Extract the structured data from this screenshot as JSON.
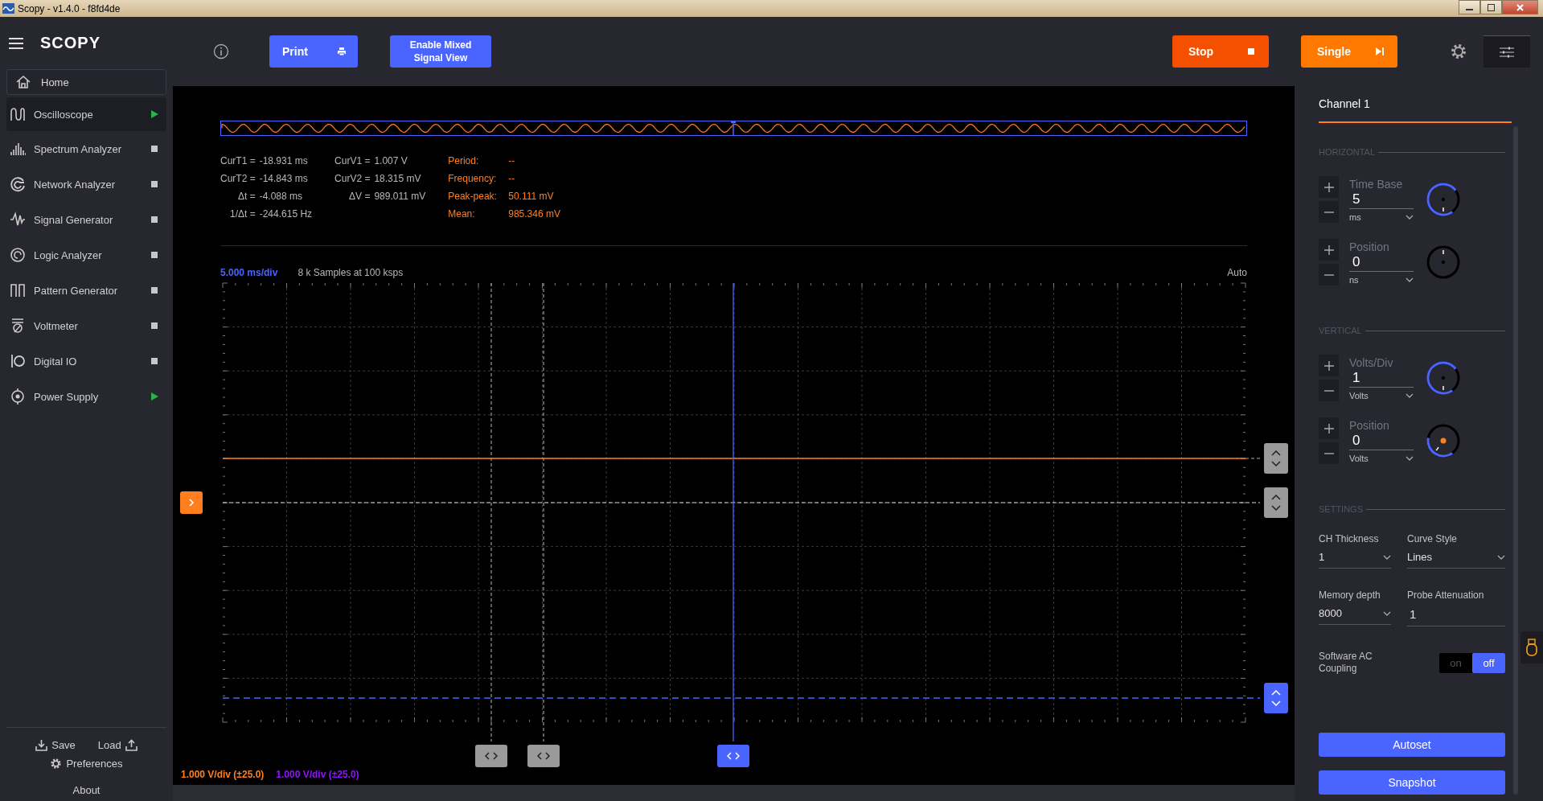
{
  "window": {
    "title": "Scopy - v1.4.0 - f8fd4de"
  },
  "sidebar": {
    "logo": "SCOPY",
    "home": "Home",
    "tools": [
      {
        "label": "Oscilloscope",
        "kind": "oscilloscope",
        "selected": true,
        "running": true
      },
      {
        "label": "Spectrum Analyzer",
        "kind": "spectrum",
        "selected": false,
        "running": false
      },
      {
        "label": "Network Analyzer",
        "kind": "network",
        "selected": false,
        "running": false
      },
      {
        "label": "Signal Generator",
        "kind": "signal",
        "selected": false,
        "running": false
      },
      {
        "label": "Logic Analyzer",
        "kind": "logic",
        "selected": false,
        "running": false
      },
      {
        "label": "Pattern Generator",
        "kind": "pattern",
        "selected": false,
        "running": false
      },
      {
        "label": "Voltmeter",
        "kind": "voltmeter",
        "selected": false,
        "running": false
      },
      {
        "label": "Digital IO",
        "kind": "digitalio",
        "selected": false,
        "running": false
      },
      {
        "label": "Power Supply",
        "kind": "power",
        "selected": false,
        "running": true
      }
    ],
    "save": "Save",
    "load": "Load",
    "preferences": "Preferences",
    "about": "About"
  },
  "toolbar": {
    "print": "Print",
    "mixed_signal": "Enable Mixed Signal View",
    "stop": "Stop",
    "single": "Single"
  },
  "cursor_readouts": {
    "time": [
      {
        "label": "CurT1 =",
        "value": "-18.931 ms"
      },
      {
        "label": "CurT2 =",
        "value": "-14.843 ms"
      },
      {
        "label": "Δt =",
        "value": "-4.088 ms"
      },
      {
        "label": "1/Δt =",
        "value": "-244.615 Hz"
      }
    ],
    "voltage": [
      {
        "label": "CurV1 =",
        "value": "1.007 V"
      },
      {
        "label": "CurV2 =",
        "value": "18.315 mV"
      },
      {
        "label": "ΔV =",
        "value": "989.011 mV"
      }
    ]
  },
  "measurements": [
    {
      "label": "Period:",
      "value": "--"
    },
    {
      "label": "Frequency:",
      "value": "--"
    },
    {
      "label": "Peak-peak:",
      "value": "50.111 mV"
    },
    {
      "label": "Mean:",
      "value": "985.346 mV"
    }
  ],
  "plot": {
    "time_div": "5.000 ms/div",
    "samples": "8 k Samples at 100 ksps",
    "trigger_mode": "Auto",
    "channel_scales": [
      {
        "text": "1.000 V/div (±25.0)",
        "color": "#ff7f1e"
      },
      {
        "text": "1.000 V/div (±25.0)",
        "color": "#9013fe"
      }
    ]
  },
  "channel_panel": {
    "tab": "Channel 1",
    "sections": [
      {
        "title": "HORIZONTAL",
        "controls": [
          {
            "label": "Time Base",
            "value": "5",
            "unit": "ms",
            "kind": "scale"
          },
          {
            "label": "Position",
            "value": "0",
            "unit": "ns",
            "kind": "position"
          }
        ]
      },
      {
        "title": "VERTICAL",
        "controls": [
          {
            "label": "Volts/Div",
            "value": "1",
            "unit": "Volts",
            "kind": "scale"
          },
          {
            "label": "Position",
            "value": "0",
            "unit": "Volts",
            "kind": "offset"
          }
        ]
      }
    ],
    "settings_title": "SETTINGS",
    "settings": [
      {
        "label": "CH Thickness",
        "value": "1",
        "kind": "dropdown"
      },
      {
        "label": "Curve Style",
        "value": "Lines",
        "kind": "dropdown"
      },
      {
        "label": "Memory depth",
        "value": "8000",
        "kind": "dropdown"
      },
      {
        "label": "Probe Attenuation",
        "value": "1",
        "kind": "field"
      }
    ],
    "ac_coupling": {
      "label": "Software AC Coupling",
      "on_label": "on",
      "off_label": "off",
      "on": false
    },
    "buttons": [
      "Autoset",
      "Snapshot"
    ]
  }
}
